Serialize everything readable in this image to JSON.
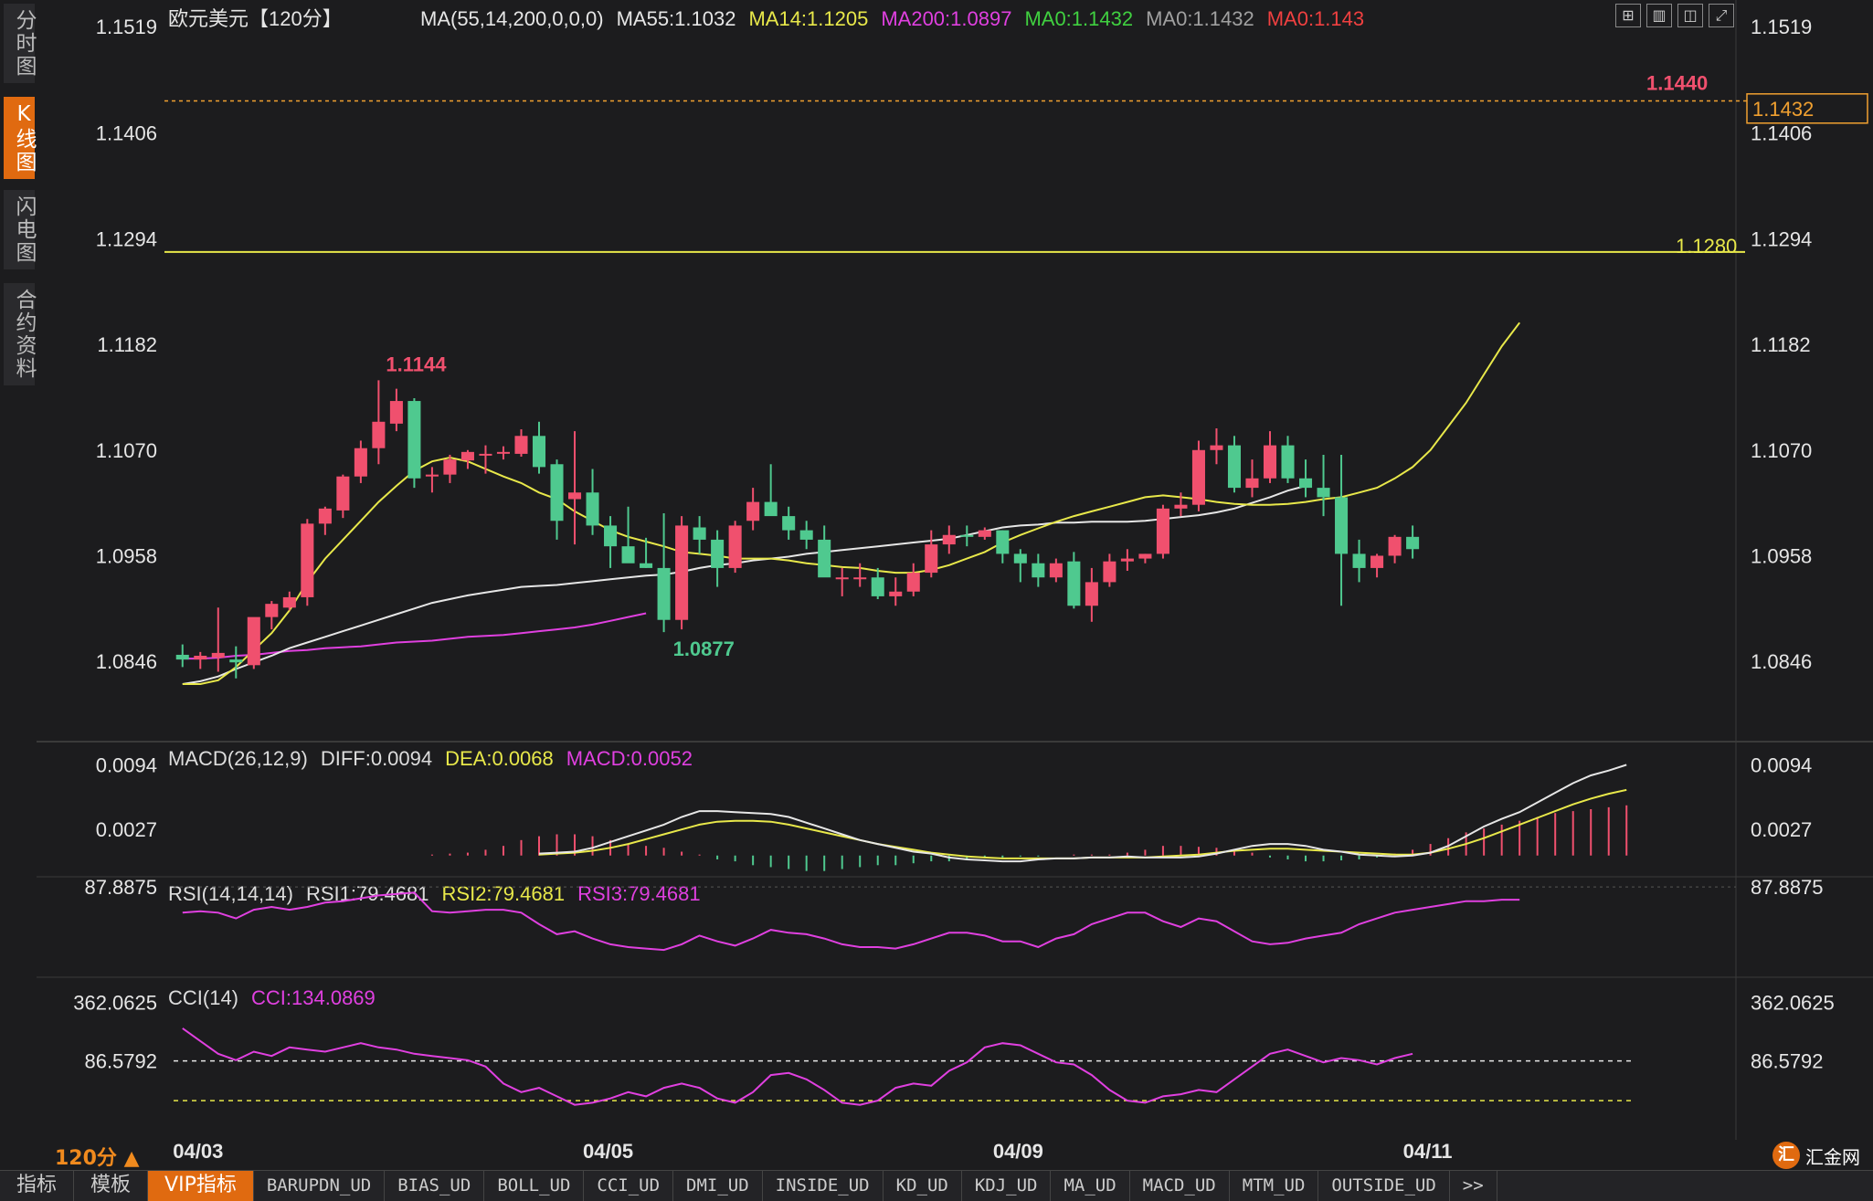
{
  "side_tabs": [
    {
      "label": "分时图",
      "active": false
    },
    {
      "label": "K线图",
      "active": true
    },
    {
      "label": "闪电图",
      "active": false
    },
    {
      "label": "合约资料",
      "active": false
    }
  ],
  "toolbar_icons": [
    "grid-layout-icon",
    "single-chart-icon",
    "split-chart-icon",
    "expand-icon"
  ],
  "bottom_tabs": [
    {
      "label": "指标",
      "big": true
    },
    {
      "label": "模板",
      "big": true
    },
    {
      "label": "VIP指标",
      "big": true,
      "active": true
    },
    {
      "label": "BARUPDN_UD"
    },
    {
      "label": "BIAS_UD"
    },
    {
      "label": "BOLL_UD"
    },
    {
      "label": "CCI_UD"
    },
    {
      "label": "DMI_UD"
    },
    {
      "label": "INSIDE_UD"
    },
    {
      "label": "KD_UD"
    },
    {
      "label": "KDJ_UD"
    },
    {
      "label": "MA_UD"
    },
    {
      "label": "MACD_UD"
    },
    {
      "label": "MTM_UD"
    },
    {
      "label": "OUTSIDE_UD"
    },
    {
      "label": ">>"
    }
  ],
  "period_label": "120分 ▲",
  "logo_text": "汇金网",
  "logo_mark": "汇",
  "colors": {
    "up": "#f0506e",
    "down": "#4fc98f",
    "ma55": "#e6e6e6",
    "ma14": "#e8e84a",
    "ma200": "#e040e0",
    "dea": "#e8e84a",
    "hline": "#e8e84a",
    "highline": "#f0a030"
  },
  "chart_data": [
    {
      "type": "candlestick",
      "name": "price",
      "title": "欧元美元【120分】",
      "legend": [
        {
          "text": "MA(55,14,200,0,0,0)",
          "color": "#e6e6e6"
        },
        {
          "text": "MA55:1.1032",
          "color": "#e6e6e6"
        },
        {
          "text": "MA14:1.1205",
          "color": "#e8e84a"
        },
        {
          "text": "MA200:1.0897",
          "color": "#e040e0"
        },
        {
          "text": "MA0:1.1432",
          "color": "#40d040"
        },
        {
          "text": "MA0:1.1432",
          "color": "#a0a0a0"
        },
        {
          "text": "MA0:1.143",
          "color": "#f04040"
        }
      ],
      "ylim": [
        1.0761,
        1.1547
      ],
      "y_ticks": [
        "1.1519",
        "1.1406",
        "1.1294",
        "1.1182",
        "1.1070",
        "1.0958",
        "1.0846"
      ],
      "x_ticks": [
        {
          "label": "04/03",
          "index": 1
        },
        {
          "label": "04/05",
          "index": 24
        },
        {
          "label": "04/09",
          "index": 47
        },
        {
          "label": "04/11",
          "index": 70
        }
      ],
      "ohlc": [
        [
          1.0853,
          1.0864,
          1.084,
          1.0848
        ],
        [
          1.0848,
          1.0856,
          1.0838,
          1.0852
        ],
        [
          1.085,
          1.0903,
          1.0835,
          1.0855
        ],
        [
          1.0848,
          1.0862,
          1.0828,
          1.0845
        ],
        [
          1.0842,
          1.0892,
          1.0838,
          1.0893
        ],
        [
          1.0893,
          1.091,
          1.088,
          1.0907
        ],
        [
          1.0903,
          1.092,
          1.09,
          1.0914
        ],
        [
          1.0914,
          1.0997,
          1.0905,
          1.0992
        ],
        [
          1.0992,
          1.101,
          1.098,
          1.1008
        ],
        [
          1.1006,
          1.1044,
          1.0998,
          1.1042
        ],
        [
          1.1042,
          1.108,
          1.1035,
          1.1072
        ],
        [
          1.1072,
          1.1144,
          1.1055,
          1.11
        ],
        [
          1.1098,
          1.1135,
          1.109,
          1.1122
        ],
        [
          1.1122,
          1.1125,
          1.103,
          1.104
        ],
        [
          1.1042,
          1.1052,
          1.1025,
          1.1044
        ],
        [
          1.1044,
          1.1065,
          1.1035,
          1.106
        ],
        [
          1.1059,
          1.107,
          1.105,
          1.1068
        ],
        [
          1.1066,
          1.1075,
          1.1045,
          1.1066
        ],
        [
          1.1068,
          1.1074,
          1.106,
          1.1068
        ],
        [
          1.1066,
          1.1092,
          1.1063,
          1.1085
        ],
        [
          1.1085,
          1.11,
          1.1045,
          1.1052
        ],
        [
          1.1055,
          1.106,
          1.0975,
          1.0995
        ],
        [
          1.1018,
          1.109,
          1.097,
          1.1025
        ],
        [
          1.1025,
          1.105,
          1.098,
          1.099
        ],
        [
          1.099,
          1.1,
          1.0945,
          1.0968
        ],
        [
          1.0968,
          1.101,
          1.0955,
          1.095
        ],
        [
          1.095,
          1.0977,
          1.0945,
          1.0945
        ],
        [
          1.0945,
          1.1003,
          1.0877,
          1.089
        ],
        [
          1.089,
          1.1,
          1.088,
          1.099
        ],
        [
          1.0988,
          1.1,
          1.096,
          1.0975
        ],
        [
          1.0975,
          1.0985,
          1.0925,
          1.0945
        ],
        [
          1.0945,
          1.0995,
          1.094,
          1.099
        ],
        [
          1.0995,
          1.103,
          1.0985,
          1.1015
        ],
        [
          1.1015,
          1.1055,
          1.1005,
          1.1
        ],
        [
          1.1,
          1.101,
          1.0975,
          1.0985
        ],
        [
          1.0985,
          1.0995,
          1.0965,
          1.0975
        ],
        [
          1.0975,
          1.099,
          1.096,
          1.0935
        ],
        [
          1.0935,
          1.0945,
          1.0915,
          1.0935
        ],
        [
          1.0935,
          1.095,
          1.0925,
          1.0935
        ],
        [
          1.0935,
          1.0945,
          1.0912,
          1.0915
        ],
        [
          1.0915,
          1.0935,
          1.0905,
          1.092
        ],
        [
          1.092,
          1.095,
          1.0915,
          1.094
        ],
        [
          1.094,
          1.0985,
          1.0935,
          1.097
        ],
        [
          1.097,
          1.099,
          1.096,
          1.098
        ],
        [
          1.098,
          1.099,
          1.0968,
          1.0978
        ],
        [
          1.0978,
          1.0988,
          1.0975,
          1.0985
        ],
        [
          1.0985,
          1.0985,
          1.095,
          1.096
        ],
        [
          1.096,
          1.0965,
          1.093,
          1.095
        ],
        [
          1.095,
          1.096,
          1.0925,
          1.0935
        ],
        [
          1.0935,
          1.0955,
          1.093,
          1.095
        ],
        [
          1.0952,
          1.0962,
          1.0902,
          1.0905
        ],
        [
          1.0905,
          1.0945,
          1.0888,
          1.093
        ],
        [
          1.093,
          1.096,
          1.0925,
          1.0952
        ],
        [
          1.0952,
          1.0965,
          1.0942,
          1.0955
        ],
        [
          1.0955,
          1.096,
          1.095,
          1.096
        ],
        [
          1.096,
          1.1012,
          1.0955,
          1.1008
        ],
        [
          1.1008,
          1.1025,
          1.1,
          1.1012
        ],
        [
          1.1012,
          1.108,
          1.1005,
          1.107
        ],
        [
          1.107,
          1.1093,
          1.1055,
          1.1075
        ],
        [
          1.1075,
          1.1085,
          1.1025,
          1.103
        ],
        [
          1.103,
          1.106,
          1.102,
          1.104
        ],
        [
          1.104,
          1.109,
          1.1035,
          1.1075
        ],
        [
          1.1075,
          1.1085,
          1.1035,
          1.104
        ],
        [
          1.104,
          1.106,
          1.102,
          1.103
        ],
        [
          1.103,
          1.1065,
          1.1,
          1.102
        ],
        [
          1.102,
          1.1065,
          1.0905,
          1.096
        ],
        [
          1.096,
          1.0975,
          1.093,
          1.0945
        ],
        [
          1.0945,
          1.096,
          1.0935,
          1.0958
        ],
        [
          1.0958,
          1.098,
          1.095,
          1.0978
        ],
        [
          1.0978,
          1.099,
          1.0955,
          1.0965
        ]
      ],
      "ma55": [
        1.0822,
        1.0825,
        1.083,
        1.0838,
        1.0845,
        1.0852,
        1.086,
        1.0866,
        1.0872,
        1.0878,
        1.0884,
        1.089,
        1.0896,
        1.0902,
        1.0908,
        1.0912,
        1.0916,
        1.0919,
        1.0922,
        1.0925,
        1.0926,
        1.0927,
        1.0929,
        1.0931,
        1.0933,
        1.0935,
        1.0937,
        1.0938,
        1.0941,
        1.0945,
        1.0948,
        1.095,
        1.0953,
        1.0955,
        1.0957,
        1.096,
        1.0962,
        1.0964,
        1.0966,
        1.0968,
        1.097,
        1.0972,
        1.0974,
        1.0976,
        1.098,
        1.0984,
        1.0988,
        1.099,
        1.0991,
        1.0993,
        1.0993,
        1.0994,
        1.0994,
        1.0994,
        1.0995,
        1.0997,
        1.0999,
        1.1001,
        1.1004,
        1.1008,
        1.1014,
        1.102,
        1.1027,
        1.1032
      ],
      "ma14": [
        1.0822,
        1.0822,
        1.0826,
        1.084,
        1.0858,
        1.0876,
        1.09,
        1.093,
        1.0955,
        1.0975,
        1.0995,
        1.1015,
        1.1032,
        1.1048,
        1.1058,
        1.1062,
        1.1058,
        1.105,
        1.1042,
        1.1035,
        1.1025,
        1.1018,
        1.1005,
        1.0995,
        1.0985,
        1.0978,
        1.0973,
        1.0968,
        1.0962,
        1.096,
        1.0958,
        1.0955,
        1.0955,
        1.0955,
        1.0953,
        1.095,
        1.0948,
        1.0946,
        1.0945,
        1.0942,
        1.094,
        1.094,
        1.0943,
        1.0948,
        1.0955,
        1.0962,
        1.0972,
        1.098,
        1.0987,
        1.0994,
        1.1,
        1.1005,
        1.101,
        1.1015,
        1.102,
        1.1022,
        1.102,
        1.1018,
        1.1015,
        1.1013,
        1.1012,
        1.1012,
        1.1013,
        1.1015,
        1.1018,
        1.102,
        1.1025,
        1.103,
        1.104,
        1.1052,
        1.107,
        1.1095,
        1.112,
        1.115,
        1.118,
        1.1205
      ],
      "ma200": [
        1.0849,
        1.0849,
        1.085,
        1.0852,
        1.0853,
        1.0855,
        1.0857,
        1.0858,
        1.086,
        1.0861,
        1.0862,
        1.0864,
        1.0866,
        1.0867,
        1.0868,
        1.087,
        1.0872,
        1.0873,
        1.0874,
        1.0876,
        1.0878,
        1.088,
        1.0882,
        1.0885,
        1.0889,
        1.0893,
        1.0897
      ],
      "high_marker": {
        "text": "1.1144",
        "index": 11,
        "value": 1.1144
      },
      "low_marker": {
        "text": "1.0877",
        "index": 27,
        "value": 1.0877
      },
      "last_high_marker": {
        "text": "1.1440",
        "value": 1.144
      },
      "last_price_box": "1.1432",
      "horizontal_line": {
        "text": "1.1280",
        "value": 1.128
      }
    },
    {
      "type": "macd",
      "legend": [
        {
          "text": "MACD(26,12,9)",
          "color": "#dddddd"
        },
        {
          "text": "DIFF:0.0094",
          "color": "#dddddd"
        },
        {
          "text": "DEA:0.0068",
          "color": "#e8e84a"
        },
        {
          "text": "MACD:0.0052",
          "color": "#e040e0"
        }
      ],
      "ylim": [
        -0.0022,
        0.0118
      ],
      "y_ticks": [
        "0.0094",
        "0.0027"
      ],
      "diff": [
        0.0002,
        0.0003,
        0.0004,
        0.0008,
        0.0014,
        0.002,
        0.0026,
        0.0032,
        0.004,
        0.0046,
        0.0046,
        0.0045,
        0.0044,
        0.0043,
        0.004,
        0.0034,
        0.0028,
        0.0022,
        0.0016,
        0.0012,
        0.0008,
        0.0004,
        0.0002,
        -0.0002,
        -0.0004,
        -0.0005,
        -0.0006,
        -0.0006,
        -0.0004,
        -0.0003,
        -0.0003,
        -0.0002,
        -0.0002,
        -0.0001,
        -0.0002,
        -0.0002,
        -0.0002,
        -0.0001,
        0.0002,
        0.0006,
        0.001,
        0.0012,
        0.0012,
        0.001,
        0.0006,
        0.0004,
        0.0001,
        0.0,
        -0.0001,
        0.0,
        0.0003,
        0.001,
        0.002,
        0.003,
        0.0038,
        0.0045,
        0.0055,
        0.0065,
        0.0075,
        0.0083,
        0.0088,
        0.0094
      ],
      "dea": [
        0.0001,
        0.0002,
        0.0003,
        0.0005,
        0.0008,
        0.0012,
        0.0017,
        0.0022,
        0.0027,
        0.0032,
        0.0035,
        0.0036,
        0.0036,
        0.0035,
        0.0032,
        0.0028,
        0.0024,
        0.002,
        0.0016,
        0.0012,
        0.0009,
        0.0006,
        0.0003,
        0.0001,
        -0.0001,
        -0.0002,
        -0.0003,
        -0.0003,
        -0.0003,
        -0.0003,
        -0.0003,
        -0.0002,
        -0.0002,
        -0.0002,
        -0.0002,
        -0.0001,
        0.0,
        0.0001,
        0.0003,
        0.0005,
        0.0006,
        0.0007,
        0.0007,
        0.0006,
        0.0005,
        0.0004,
        0.0003,
        0.0002,
        0.0001,
        0.0001,
        0.0003,
        0.0007,
        0.0012,
        0.0018,
        0.0025,
        0.0032,
        0.0039,
        0.0046,
        0.0053,
        0.0059,
        0.0064,
        0.0068
      ],
      "hist": [
        0.0001,
        0.0002,
        0.0003,
        0.0006,
        0.001,
        0.0016,
        0.002,
        0.0022,
        0.0022,
        0.002,
        0.0016,
        0.0012,
        0.001,
        0.0008,
        0.0004,
        0.0001,
        -0.0004,
        -0.0006,
        -0.001,
        -0.0012,
        -0.0014,
        -0.0016,
        -0.0016,
        -0.0014,
        -0.0012,
        -0.001,
        -0.001,
        -0.0008,
        -0.0006,
        -0.0006,
        -0.0004,
        -0.0003,
        -0.0002,
        -0.0001,
        -0.0001,
        0.0,
        0.0001,
        0.0001,
        0.0001,
        0.0003,
        0.0006,
        0.001,
        0.001,
        0.0009,
        0.0008,
        0.0006,
        0.0003,
        -0.0002,
        -0.0004,
        -0.0006,
        -0.0006,
        -0.0005,
        -0.0004,
        -0.0002,
        0.0002,
        0.0006,
        0.0012,
        0.0018,
        0.0024,
        0.0028,
        0.0032,
        0.0036,
        0.004,
        0.0044,
        0.0046,
        0.0048,
        0.005,
        0.0052
      ]
    },
    {
      "type": "line",
      "name": "rsi",
      "legend": [
        {
          "text": "RSI(14,14,14)",
          "color": "#dddddd"
        },
        {
          "text": "RSI1:79.4681",
          "color": "#dddddd"
        },
        {
          "text": "RSI2:79.4681",
          "color": "#e8e84a"
        },
        {
          "text": "RSI3:79.4681",
          "color": "#e040e0"
        }
      ],
      "ylim": [
        25,
        95
      ],
      "y_ticks": [
        "87.8875"
      ],
      "values": [
        70,
        71,
        70,
        66,
        72,
        74,
        72,
        74,
        77,
        78,
        80,
        82,
        83,
        84,
        71,
        70,
        71,
        72,
        72,
        70,
        62,
        55,
        57,
        52,
        48,
        46,
        45,
        44,
        48,
        54,
        50,
        47,
        52,
        58,
        56,
        55,
        52,
        48,
        46,
        46,
        45,
        48,
        52,
        56,
        56,
        54,
        50,
        50,
        46,
        52,
        55,
        62,
        66,
        70,
        70,
        64,
        60,
        66,
        64,
        57,
        50,
        48,
        49,
        52,
        54,
        56,
        62,
        66,
        70,
        72,
        74,
        76,
        78,
        78,
        79,
        79
      ]
    },
    {
      "type": "line",
      "name": "cci",
      "legend": [
        {
          "text": "CCI(14)",
          "color": "#dddddd"
        },
        {
          "text": "CCI:134.0869",
          "color": "#e040e0"
        }
      ],
      "ylim": [
        -250,
        480
      ],
      "y_ticks": [
        "362.0625",
        "86.5792"
      ],
      "values": [
        240,
        180,
        120,
        90,
        130,
        110,
        150,
        140,
        130,
        150,
        170,
        150,
        140,
        120,
        110,
        100,
        90,
        60,
        -20,
        -60,
        -40,
        -80,
        -120,
        -110,
        -90,
        -60,
        -80,
        -40,
        -20,
        -40,
        -90,
        -110,
        -60,
        20,
        30,
        0,
        -50,
        -110,
        -120,
        -100,
        -40,
        -20,
        -30,
        40,
        80,
        150,
        170,
        160,
        120,
        80,
        70,
        20,
        -50,
        -100,
        -110,
        -80,
        -70,
        -50,
        -60,
        0,
        60,
        120,
        140,
        110,
        80,
        100,
        90,
        70,
        100,
        120
      ]
    }
  ]
}
